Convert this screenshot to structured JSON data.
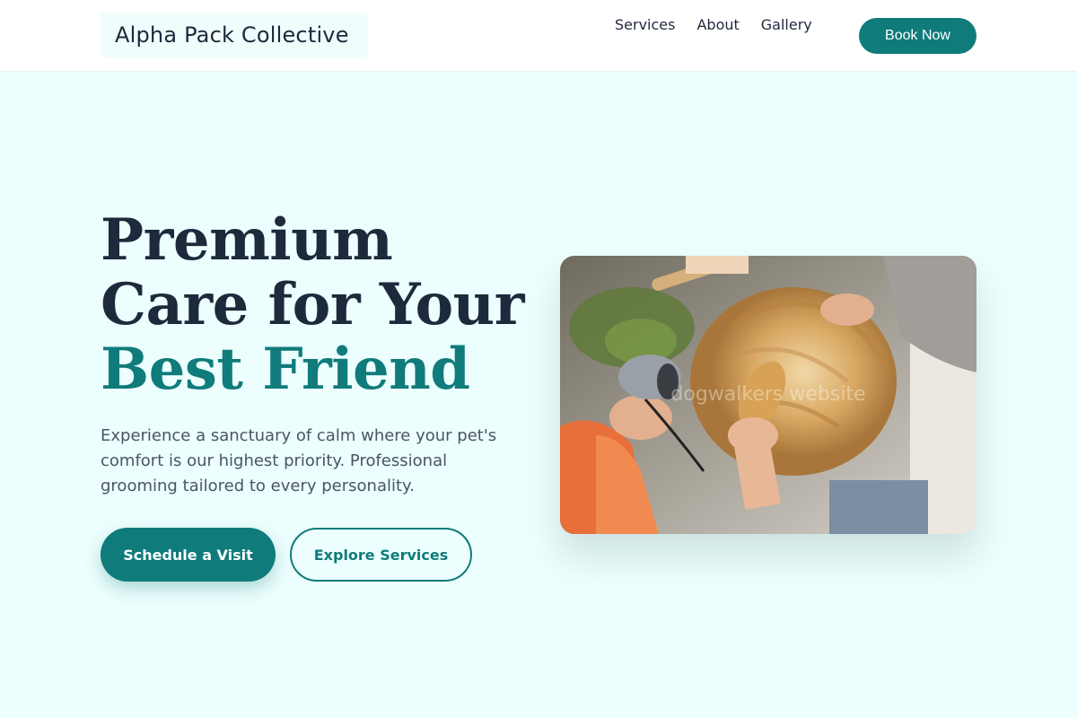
{
  "header": {
    "logo_text": "Alpha Pack Collective",
    "nav": [
      {
        "label": "Services"
      },
      {
        "label": "About"
      },
      {
        "label": "Gallery"
      }
    ],
    "cta_label": "Book Now"
  },
  "hero": {
    "title_line1": "Premium",
    "title_line2": "Care for Your",
    "title_accent": "Best Friend",
    "subtitle": "Experience a sanctuary of calm where your pet's comfort is our highest priority. Professional grooming tailored to every personality.",
    "primary_button": "Schedule a Visit",
    "secondary_button": "Explore Services",
    "image_watermark": "dogwalkers website"
  },
  "colors": {
    "accent": "#0f7b7b",
    "background": "#ecfefd",
    "heading": "#1e293b"
  }
}
